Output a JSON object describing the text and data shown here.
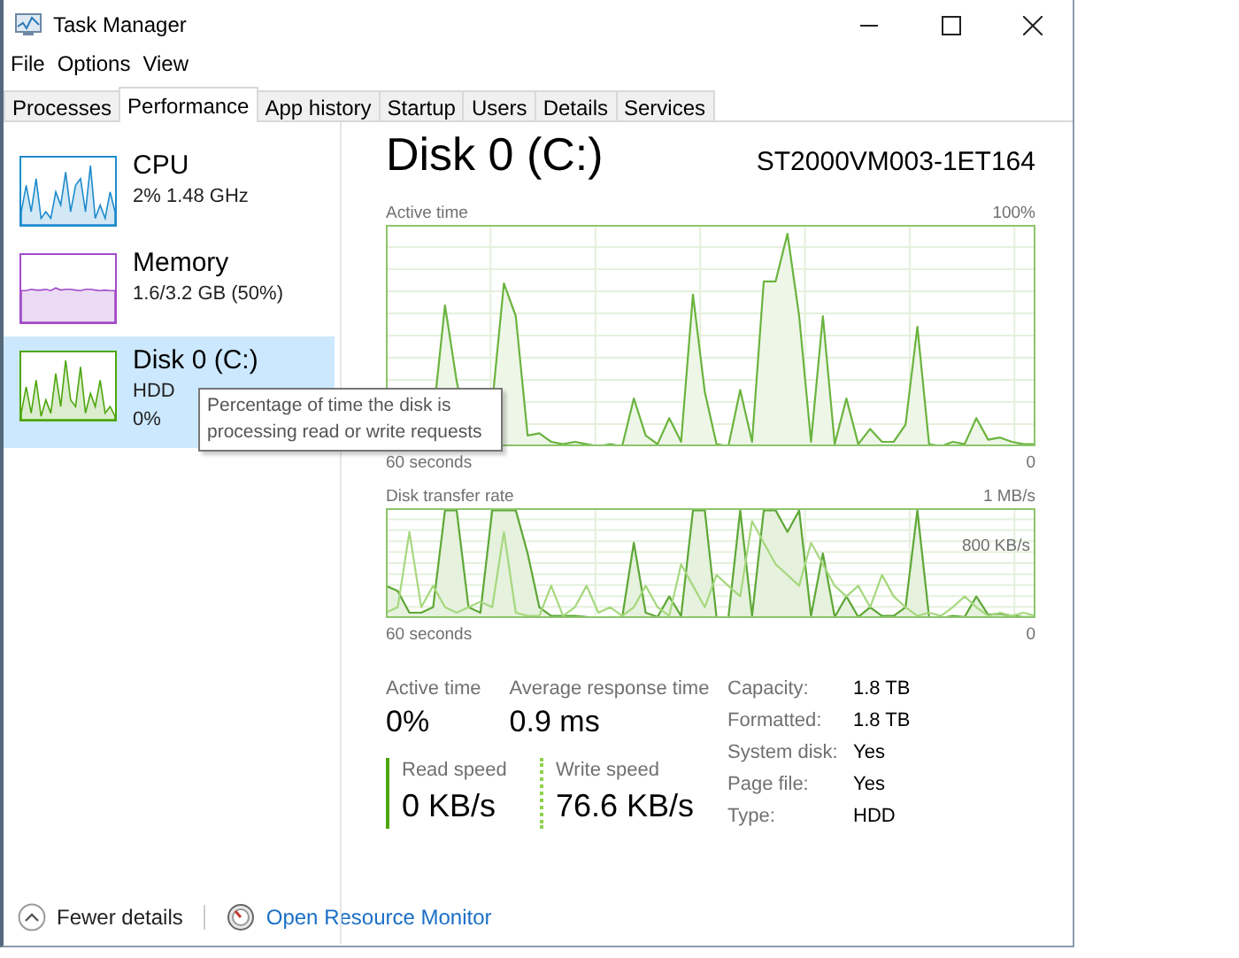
{
  "window": {
    "title": "Task Manager"
  },
  "menu": [
    "File",
    "Options",
    "View"
  ],
  "tabs": [
    {
      "label": "Processes",
      "selected": false
    },
    {
      "label": "Performance",
      "selected": true
    },
    {
      "label": "App history",
      "selected": false
    },
    {
      "label": "Startup",
      "selected": false
    },
    {
      "label": "Users",
      "selected": false
    },
    {
      "label": "Details",
      "selected": false
    },
    {
      "label": "Services",
      "selected": false
    }
  ],
  "sidebar": {
    "items": [
      {
        "name": "CPU",
        "lines": [
          "2%  1.48 GHz"
        ],
        "color": "#1e8bcd",
        "selected": false
      },
      {
        "name": "Memory",
        "lines": [
          "1.6/3.2 GB (50%)"
        ],
        "color": "#a24cc8",
        "selected": false
      },
      {
        "name": "Disk 0 (C:)",
        "lines": [
          "HDD",
          "0%"
        ],
        "color": "#4da60c",
        "selected": true
      }
    ]
  },
  "tooltip": {
    "text": "Percentage of time the disk is processing read or write requests"
  },
  "header": {
    "title": "Disk 0 (C:)",
    "model": "ST2000VM003-1ET164"
  },
  "charts": [
    {
      "label": "Active time",
      "max": "100%",
      "start": "60 seconds",
      "end": "0"
    },
    {
      "label": "Disk transfer rate",
      "max": "1 MB/s",
      "start": "60 seconds",
      "end": "0",
      "inner_label": "800 KB/s"
    }
  ],
  "stats": [
    {
      "label": "Active time",
      "value": "0%"
    },
    {
      "label": "Average response time",
      "value": "0.9 ms"
    }
  ],
  "speeds": [
    {
      "label": "Read speed",
      "value": "0 KB/s",
      "kind": "solid"
    },
    {
      "label": "Write speed",
      "value": "76.6 KB/s",
      "kind": "dotted"
    }
  ],
  "properties": [
    {
      "label": "Capacity:",
      "value": "1.8 TB"
    },
    {
      "label": "Formatted:",
      "value": "1.8 TB"
    },
    {
      "label": "System disk:",
      "value": "Yes"
    },
    {
      "label": "Page file:",
      "value": "Yes"
    },
    {
      "label": "Type:",
      "value": "HDD"
    }
  ],
  "footer": {
    "toggle": "Fewer details",
    "link": "Open Resource Monitor"
  }
}
